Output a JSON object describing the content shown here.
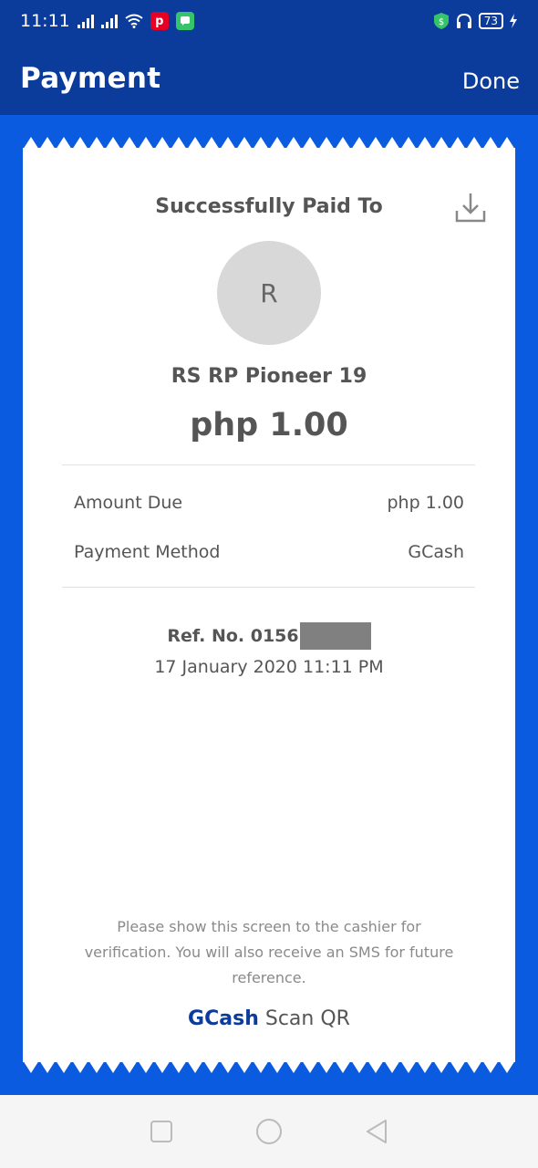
{
  "status_bar": {
    "time": "11:11",
    "battery": "73",
    "icons": [
      "signal-icon",
      "signal-icon",
      "wifi-icon",
      "pinterest-icon",
      "message-icon",
      "shield-icon",
      "headset-icon",
      "battery-icon",
      "charging-icon"
    ]
  },
  "header": {
    "title": "Payment",
    "done_label": "Done"
  },
  "receipt": {
    "title": "Successfully Paid To",
    "avatar_initial": "R",
    "merchant_name": "RS RP Pioneer 19",
    "amount": "php 1.00",
    "details": [
      {
        "label": "Amount Due",
        "value": "php 1.00"
      },
      {
        "label": "Payment Method",
        "value": "GCash"
      }
    ],
    "ref_label": "Ref. No. 0156",
    "datetime": "17 January 2020 11:11 PM",
    "note": "Please show this screen to the cashier for verification. You will also receive an SMS for future reference.",
    "brand_name": "GCash",
    "brand_suffix": "Scan QR"
  },
  "colors": {
    "header_bg": "#0b3b9b",
    "page_bg": "#0a5bdf",
    "brand_blue": "#0b3b9b"
  },
  "navbar": {
    "icons": [
      "recent-apps-icon",
      "home-icon",
      "back-icon"
    ]
  }
}
